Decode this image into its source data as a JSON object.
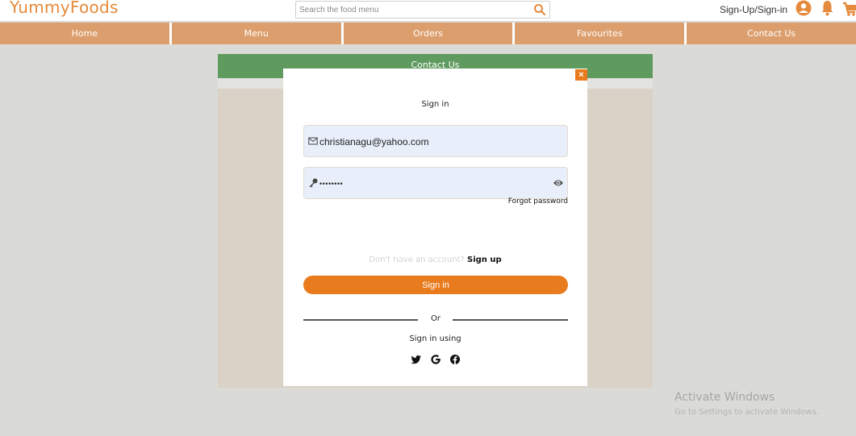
{
  "header": {
    "logo": "YummyFoods",
    "search_placeholder": "Search the food menu",
    "auth_link": "Sign-Up/Sign-in"
  },
  "nav": {
    "items": [
      "Home",
      "Menu",
      "Orders",
      "Favourites",
      "Contact Us"
    ]
  },
  "contact_section": {
    "title": "Contact Us"
  },
  "modal": {
    "close": "×",
    "title": "Sign in",
    "email_value": "christianagu@yahoo.com",
    "password_value": "••••••••",
    "forgot": "Forgot password",
    "signup_prompt": "Don't have an account?",
    "signup_link": "Sign up",
    "signin_button": "Sign in",
    "or": "Or",
    "sign_in_using": "Sign in using",
    "social": [
      "twitter-icon",
      "google-icon",
      "facebook-icon"
    ]
  },
  "watermark": {
    "title": "Activate Windows",
    "subtitle": "Go to Settings to activate Windows."
  },
  "colors": {
    "logo": "#e58a3c",
    "nav": "#dc9e6c",
    "contact_header": "#5f9b5f",
    "accent": "#e87b1e"
  }
}
